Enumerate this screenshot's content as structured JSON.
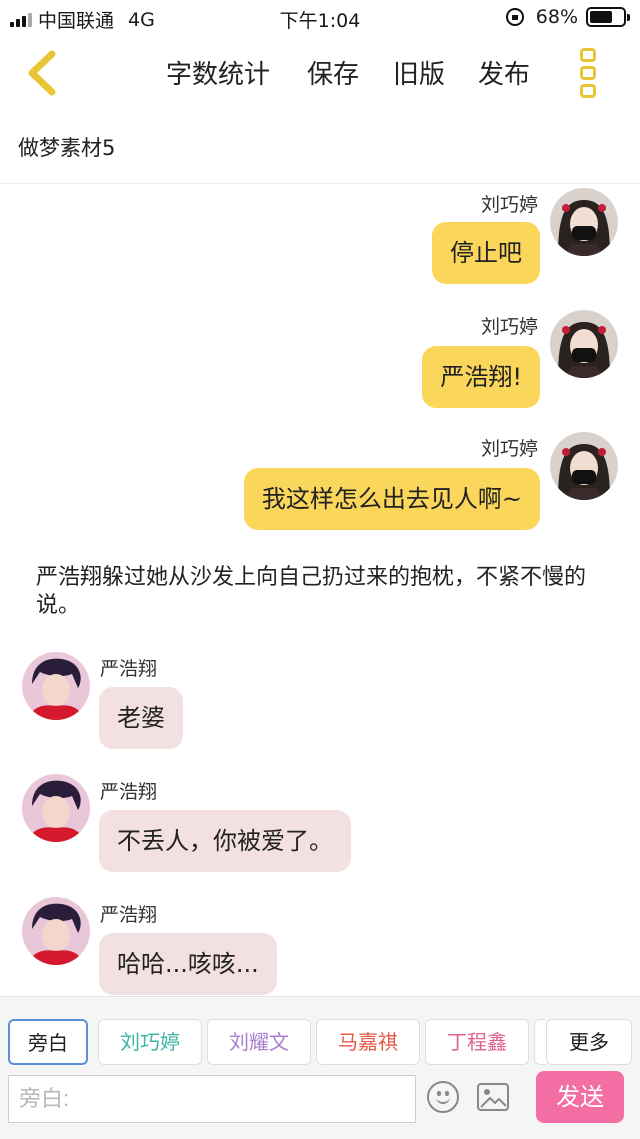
{
  "status_bar": {
    "carrier": "中国联通",
    "network": "4G",
    "time": "下午1:04",
    "battery": "68%",
    "battery_level": 0.68
  },
  "toolbar": {
    "word_count": "字数统计",
    "save": "保存",
    "old_version": "旧版",
    "publish": "发布"
  },
  "document_title": "做梦素材5",
  "messages": [
    {
      "speaker": "刘巧婷",
      "text": "停止吧"
    },
    {
      "speaker": "刘巧婷",
      "text": "严浩翔!"
    },
    {
      "speaker": "刘巧婷",
      "text": "我这样怎么出去见人啊~"
    },
    {
      "narration": "严浩翔躲过她从沙发上向自己扔过来的抱枕，不紧不慢的说。"
    },
    {
      "speaker": "严浩翔",
      "text": "老婆"
    },
    {
      "speaker": "严浩翔",
      "text": "不丢人，你被爱了。"
    },
    {
      "speaker": "严浩翔",
      "text": "哈哈...咳咳..."
    }
  ],
  "roles": [
    {
      "label": "旁白",
      "color": "#222222"
    },
    {
      "label": "刘巧婷",
      "color": "#3fb3a8"
    },
    {
      "label": "刘耀文",
      "color": "#a77fcf"
    },
    {
      "label": "马嘉祺",
      "color": "#e45a4a"
    },
    {
      "label": "丁程鑫",
      "color": "#e0608f"
    }
  ],
  "more_roles": "更多",
  "input": {
    "placeholder": "旁白:"
  },
  "send_button": "发送",
  "colors": {
    "right_bubble": "#fad65a",
    "left_bubble": "#f3e0e1",
    "send": "#f36fa3",
    "accent_yellow": "#e8c637"
  }
}
